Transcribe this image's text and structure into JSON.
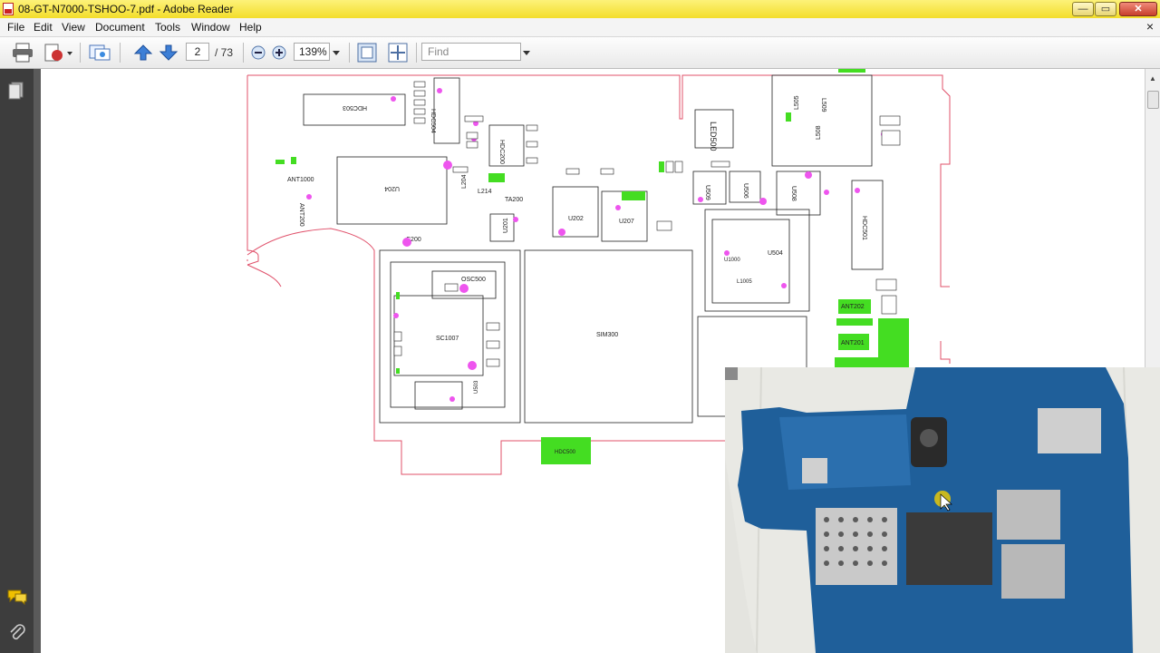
{
  "window": {
    "title": "08-GT-N7000-TSHOO-7.pdf - Adobe Reader",
    "min_glyph": "—",
    "max_glyph": "▭",
    "close_glyph": "✕"
  },
  "menu": {
    "items": [
      "File",
      "Edit",
      "View",
      "Document",
      "Tools",
      "Window",
      "Help"
    ],
    "close_glyph": "×"
  },
  "toolbar": {
    "page_current": "2",
    "page_total": "/ 73",
    "zoom": "139%",
    "find_placeholder": "Find"
  },
  "schematic": {
    "labels": {
      "hdc503": "HDC503",
      "hdc504": "HDC504",
      "ant1000": "ANT1000",
      "ant200": "ANT200",
      "u204": "U204",
      "l204": "L204",
      "hdc200": "HDC200",
      "l214": "L214",
      "ta200": "TA200",
      "u201": "U201",
      "c200": "C200",
      "u202": "U202",
      "u207": "U207",
      "led500": "LED500",
      "l505": "L505",
      "l509": "L509",
      "l508": "L508",
      "u506": "U506",
      "u508": "U508",
      "u509": "U509",
      "hdc501": "HDC501",
      "u1000": "U1000",
      "u504": "U504",
      "l1005": "L1005",
      "osc500": "OSC500",
      "sc1007": "SC1007",
      "sim300": "SIM300",
      "ant202": "ANT202",
      "ant201": "ANT201",
      "hdc500": "HDC500",
      "u1003": "U503"
    }
  },
  "colors": {
    "title_bar": "#f6e64a",
    "outline": "#e0506a",
    "pad_green": "#33ee22",
    "pad_magenta": "#ee55ee",
    "nav_bg": "#3d3d3d"
  }
}
